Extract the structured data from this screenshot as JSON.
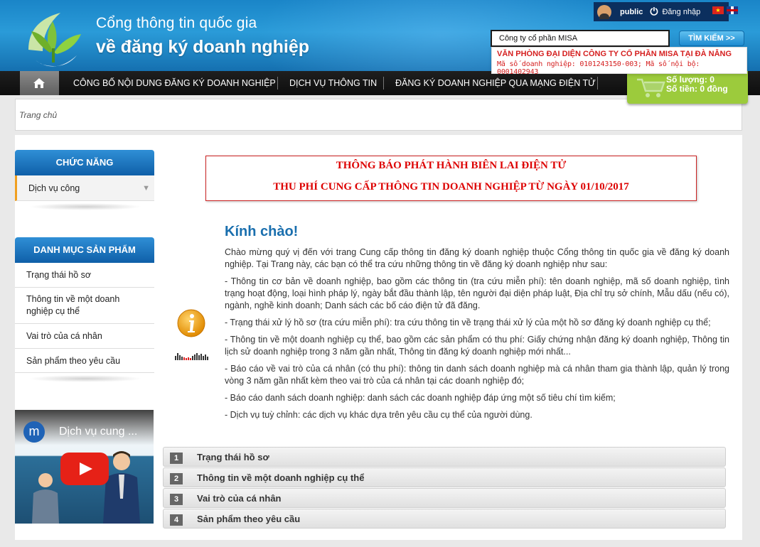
{
  "header": {
    "title_line1": "Cổng thông tin quốc gia",
    "title_line2": "về đăng ký doanh nghiệp"
  },
  "topbar": {
    "user": "public",
    "login_label": "Đăng nhập",
    "lang_vn_icon": "vietnam-flag-icon",
    "lang_en_icon": "uk-flag-icon"
  },
  "search": {
    "value": "Công ty cổ phần MISA",
    "button_label": "TÌM KIẾM >>",
    "suggestion": {
      "name": "VĂN PHÒNG ĐẠI DIỆN CÔNG TY CỔ PHẦN MISA TẠI ĐÀ NẴNG",
      "codes": "Mã số doanh nghiệp: 0101243150-003; Mã số nội bộ: 0001402943"
    }
  },
  "nav": {
    "items": [
      "CÔNG BỐ NỘI DUNG ĐĂNG KÝ DOANH NGHIỆP",
      "DỊCH VỤ THÔNG TIN",
      "ĐĂNG KÝ DOANH NGHIỆP QUA MẠNG ĐIỆN TỬ"
    ]
  },
  "cart": {
    "quantity": "Số lượng: 0",
    "total": "Số tiền: 0 đồng"
  },
  "breadcrumb": "Trang chủ",
  "sidebar": {
    "functions_title": "CHỨC NĂNG",
    "functions_item": "Dịch vụ công",
    "products_title": "DANH MỤC SẢN PHẨM",
    "products": [
      "Trạng thái hồ sơ",
      "Thông tin về một doanh nghiệp cụ thể",
      "Vai trò của cá nhân",
      "Sản phẩm theo yêu cầu"
    ],
    "video_title": "Dịch vụ cung ..."
  },
  "notice": {
    "line1": "THÔNG BÁO PHÁT HÀNH BIÊN LAI ĐIỆN TỬ",
    "line2": "THU PHÍ CUNG CẤP THÔNG TIN DOANH NGHIỆP TỪ NGÀY 01/10/2017"
  },
  "main": {
    "welcome": "Kính chào!",
    "paragraphs": [
      "Chào mừng quý vị đến với trang Cung cấp thông tin đăng ký doanh nghiệp thuộc Cổng thông tin quốc gia về đăng ký doanh nghiệp. Tại Trang này, các bạn có thể tra cứu những thông tin về đăng ký doanh nghiệp như sau:",
      "- Thông tin cơ bản về doanh nghiệp, bao gồm các thông tin (tra cứu miễn phí): tên doanh nghiệp, mã số doanh nghiệp, tình trạng hoạt động, loại hình pháp lý, ngày bắt đầu thành lập, tên người đại diện pháp luật, Địa chỉ trụ sở chính, Mẫu dấu (nếu có), ngành, nghề kinh doanh; Danh sách các bố cáo điện tử đã đăng.",
      "- Trạng thái xử lý hồ sơ (tra cứu miễn phí): tra cứu thông tin về trạng thái xử lý của một hồ sơ đăng ký doanh nghiệp cụ thể;",
      "- Thông tin về một doanh nghiệp cụ thể, bao gồm các sản phẩm có thu phí: Giấy chứng nhận đăng ký doanh nghiệp, Thông tin lịch sử doanh nghiệp trong 3 năm gần nhất, Thông tin đăng ký doanh nghiệp mới nhất...",
      "- Báo cáo về vai trò của cá nhân (có thu phí): thông tin danh sách doanh nghiệp mà cá nhân tham gia thành lập, quản lý trong vòng 3 năm gần nhất kèm theo vai trò của cá nhân tại các doanh nghiệp đó;",
      "- Báo cáo danh sách doanh nghiệp: danh sách các doanh nghiệp đáp ứng một số tiêu chí tìm kiếm;",
      "- Dịch vụ tuỳ chỉnh: các dịch vụ khác dựa trên yêu cầu cụ thể của người dùng."
    ]
  },
  "accordion": [
    {
      "num": "1",
      "label": "Trạng thái hồ sơ"
    },
    {
      "num": "2",
      "label": "Thông tin về một doanh nghiệp cụ thể"
    },
    {
      "num": "3",
      "label": "Vai trò của cá nhân"
    },
    {
      "num": "4",
      "label": "Sản phẩm theo yêu cầu"
    }
  ],
  "colors": {
    "header_blue": "#1a85c8",
    "nav_black": "#111111",
    "cart_green": "#9ccb3c",
    "notice_red": "#dd0000",
    "welcome_blue": "#1a6fae"
  }
}
